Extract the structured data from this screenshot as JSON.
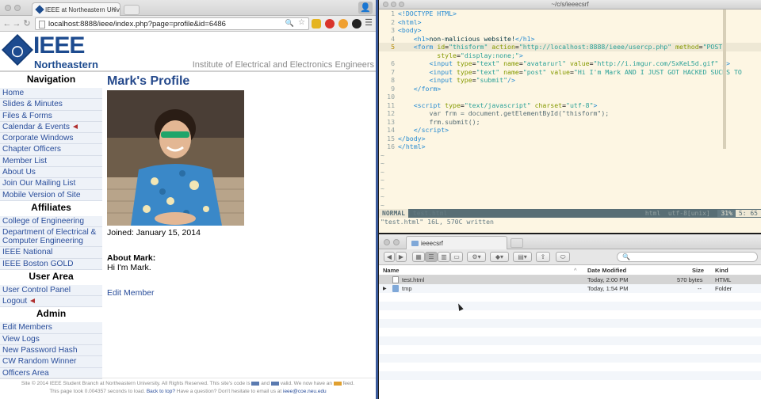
{
  "browser": {
    "tab_title": "IEEE at Northeastern Univ...",
    "url": "localhost:8888/ieee/index.php?page=profile&id=6486"
  },
  "site": {
    "logo_ieee": "IEEE",
    "logo_sub": "Northeastern",
    "institute": "Institute of Electrical and Electronics Engineers",
    "sections": [
      {
        "title": "Navigation",
        "items": [
          "Home",
          "Slides & Minutes",
          "Files & Forms",
          "Calendar & Events",
          "Corporate Windows",
          "Chapter Officers",
          "Member List",
          "About Us",
          "Join Our Mailing List",
          "Mobile Version of Site"
        ]
      },
      {
        "title": "Affiliates",
        "items": [
          "College of Engineering",
          "Department of Electrical & Computer Engineering",
          "IEEE National",
          "IEEE Boston GOLD"
        ]
      },
      {
        "title": "User Area",
        "items": [
          "User Control Panel",
          "Logout"
        ]
      },
      {
        "title": "Admin",
        "items": [
          "Edit Members",
          "View Logs",
          "New Password Hash",
          "CW Random Winner",
          "Officers Area"
        ]
      }
    ],
    "profile": {
      "title": "Mark's Profile",
      "joined": "Joined: January 15, 2014",
      "about_heading": "About Mark:",
      "about_text": "Hi I'm Mark.",
      "edit_link": "Edit Member"
    },
    "footer": {
      "line1a": "Site © 2014 IEEE Student Branch at Northeastern University. All Rights Reserved. This site's code is",
      "line1b": "and",
      "line1c": "valid. We now have an",
      "line1d": "feed.",
      "line2a": "This page took 0.004357 seconds to load.",
      "line2b": "Back to top?",
      "line2c": "Have a question? Don't hesitate to email us at",
      "line2d": "ieee@coe.neu.edu"
    }
  },
  "vim": {
    "window_title": "~/c/s/ieeecsrf",
    "status_mode": "NORMAL",
    "status_file": "test.html",
    "status_ft": "html",
    "status_enc": "utf-8[unix]",
    "status_pct": "31%",
    "status_pos": "5: 65",
    "message": "\"test.html\" 16L, 570C written",
    "current_line": 5,
    "tilde_count": 8
  },
  "finder": {
    "tab_title": "ieeecsrf",
    "columns": {
      "name": "Name",
      "date": "Date Modified",
      "size": "Size",
      "kind": "Kind"
    },
    "files": [
      {
        "name": "test.html",
        "date": "Today, 2:00 PM",
        "size": "570 bytes",
        "kind": "HTML",
        "type": "html",
        "selected": true
      },
      {
        "name": "tmp",
        "date": "Today, 1:54 PM",
        "size": "--",
        "kind": "Folder",
        "type": "folder",
        "selected": false
      }
    ]
  },
  "colors": {
    "ieee_blue": "#1d4b8f",
    "link": "#2a4e9b",
    "vim_bg": "#fdf6e3"
  }
}
